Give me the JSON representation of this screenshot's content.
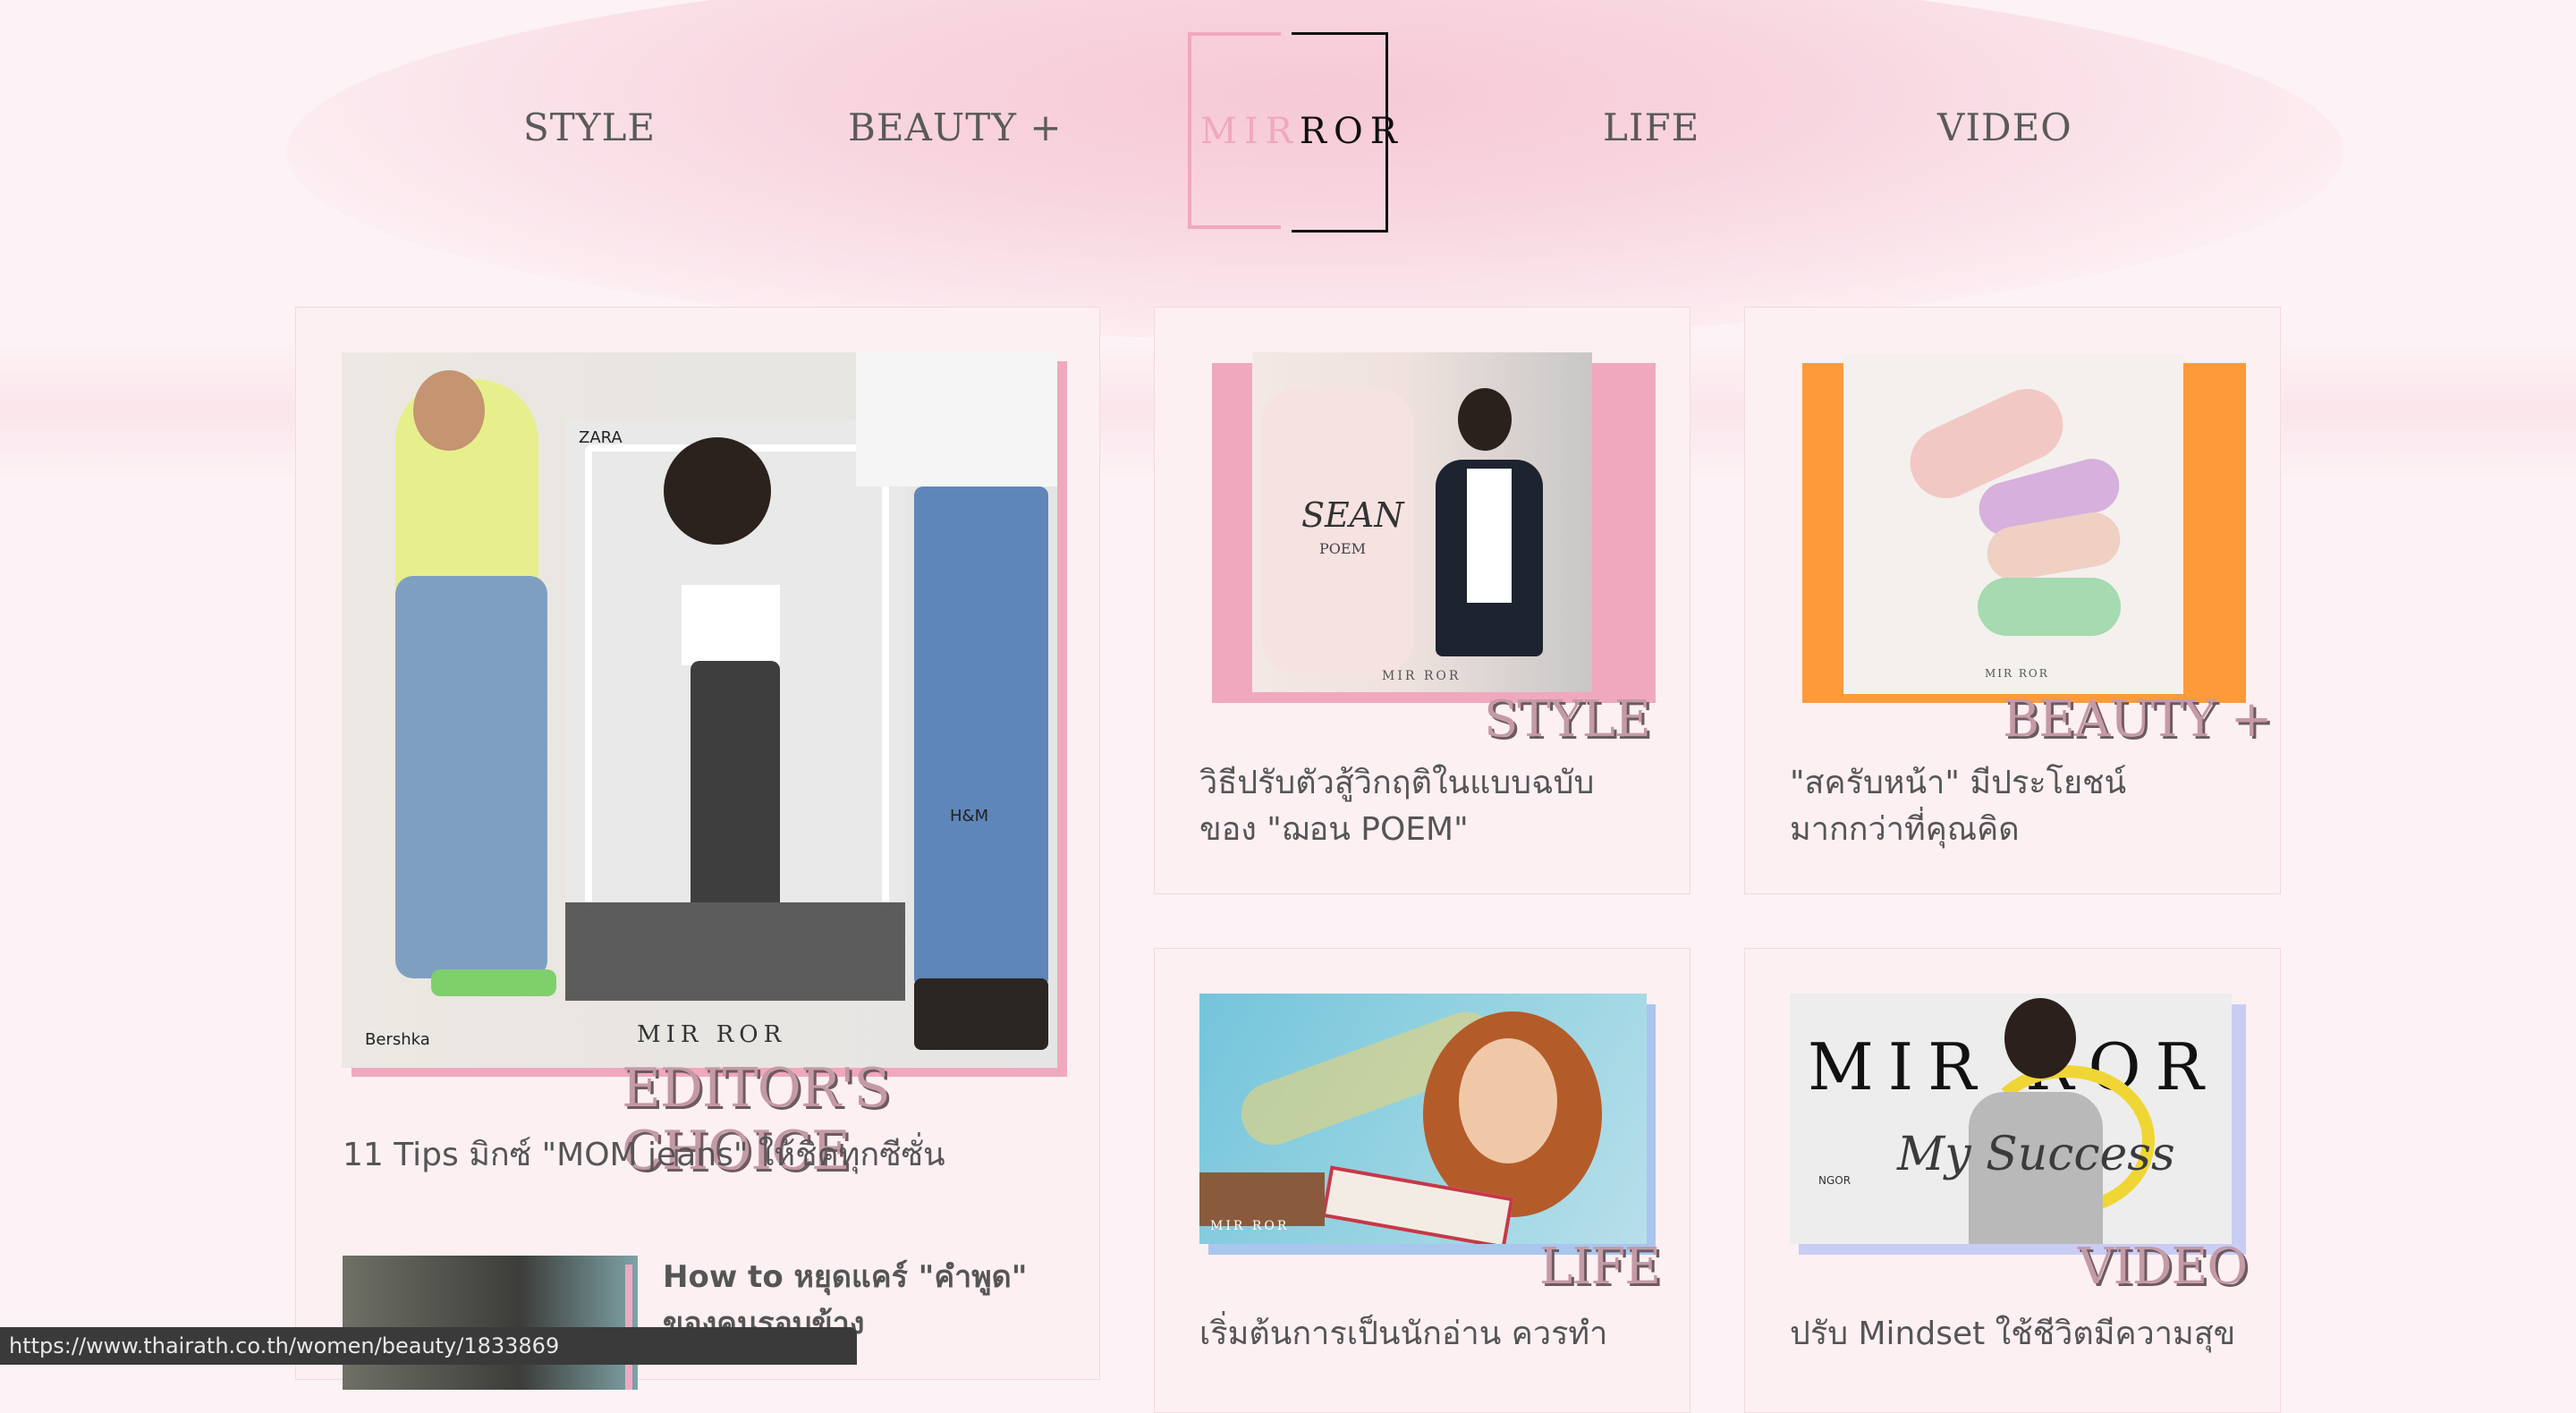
{
  "nav": {
    "items": [
      {
        "label": "STYLE"
      },
      {
        "label": "BEAUTY +"
      },
      {
        "label": "LIFE"
      },
      {
        "label": "VIDEO"
      }
    ],
    "logo": {
      "left": "MIR",
      "right": "ROR"
    }
  },
  "cards": [
    {
      "category": "EDITOR'S CHOICE",
      "headline": "11 Tips มิกซ์ \"MOM jeans\" ให้ชิคทุกซีซั่น",
      "image_labels": {
        "brand1": "ZARA",
        "brand2": "H&M",
        "brand3": "Bershka",
        "watermark": "MIR ROR"
      }
    },
    {
      "category": "STYLE",
      "headline": "วิธีปรับตัวสู้วิกฤติในแบบฉบับของ \"ฌอน POEM\"",
      "image_labels": {
        "title": "SEAN",
        "subtitle": "POEM",
        "watermark": "MIR ROR"
      }
    },
    {
      "category": "BEAUTY +",
      "headline": "\"สครับหน้า\" มีประโยชน์มากกว่าที่คุณคิด",
      "image_labels": {
        "watermark": "MIR ROR"
      }
    },
    {
      "category": "LIFE",
      "headline": "เริ่มต้นการเป็นนักอ่าน ควรทำ",
      "image_labels": {
        "watermark": "MIR ROR"
      }
    },
    {
      "category": "VIDEO",
      "headline": "ปรับ Mindset ใช้ชีวิตมีความสุข",
      "image_labels": {
        "brand": "MIR ROR",
        "script": "My Success",
        "name": "NGOR"
      }
    }
  ],
  "secondary": {
    "headline": "How to หยุดแคร์ \"คำพูด\" ของคนรอบข้าง"
  },
  "status_url": "https://www.thairath.co.th/women/beauty/1833869",
  "colors": {
    "pink": "#f0a8bf",
    "orange": "#fd9a3a",
    "blue": "#a9c6ee",
    "lavender": "#c9cdf4"
  }
}
